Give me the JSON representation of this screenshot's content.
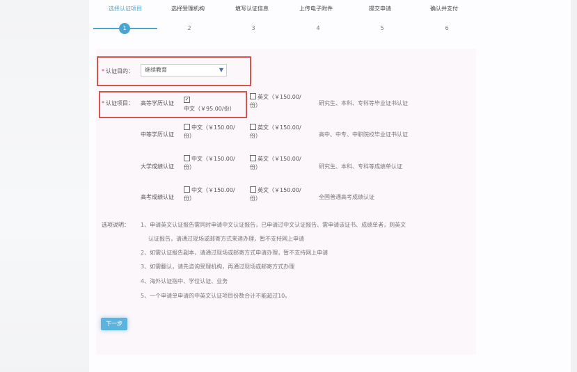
{
  "steps": [
    {
      "label": "选择认证项目",
      "number": "1"
    },
    {
      "label": "选择受理机构",
      "number": "2"
    },
    {
      "label": "填写认证信息",
      "number": "3"
    },
    {
      "label": "上传电子附件",
      "number": "4"
    },
    {
      "label": "提交申请",
      "number": "5"
    },
    {
      "label": "确认并支付",
      "number": "6"
    }
  ],
  "purpose": {
    "label": "认证目的：",
    "required_mark": "*",
    "selected": "继续教育",
    "arrow": "▼"
  },
  "items_label": "认证项目：",
  "items_required_mark": "*",
  "cert_items": [
    {
      "name": "高等学历认证",
      "cn": "中文（￥95.00/份）",
      "cn_checked": true,
      "en": "英文（￥150.00/份）",
      "desc": "研究生、本科、专科等毕业证书认证"
    },
    {
      "name": "中等学历认证",
      "cn": "中文（￥150.00/份）",
      "cn_checked": false,
      "en": "英文（￥150.00/份）",
      "desc": "高中、中专、中职院校毕业证书认证"
    },
    {
      "name": "大学成绩认证",
      "cn": "中文（￥150.00/份）",
      "cn_checked": false,
      "en": "英文（￥150.00/份）",
      "desc": "研究生、本科、专科等成绩单认证"
    },
    {
      "name": "高考成绩认证",
      "cn": "中文（￥150.00/份）",
      "cn_checked": false,
      "en": "英文（￥150.00/份）",
      "desc": "全国普通高考成绩认证"
    }
  ],
  "notes_title": "选项说明：",
  "notes": [
    "1、申请英文认证报告需同时申请中文认证报告，已申请过中文认证报告、需申请该证书、成绩单者，则英文",
    "认证报告，请通过现场或邮寄方式来递办理，暂不支持网上申请",
    "2、如需认证报告副本，请通过现场或邮寄方式申请办理，暂不支持网上申请",
    "3、如需翻认，请先咨询受理机构，再通过现场或邮寄方式办理",
    "4、海外认证指中、学位认证、业务",
    "5、一个申请单申请的中英文认证项目份数合计不能超过10。"
  ],
  "next_button": "下一步",
  "accent_color": "#4aa6d0",
  "highlight_color": "#d9534f"
}
